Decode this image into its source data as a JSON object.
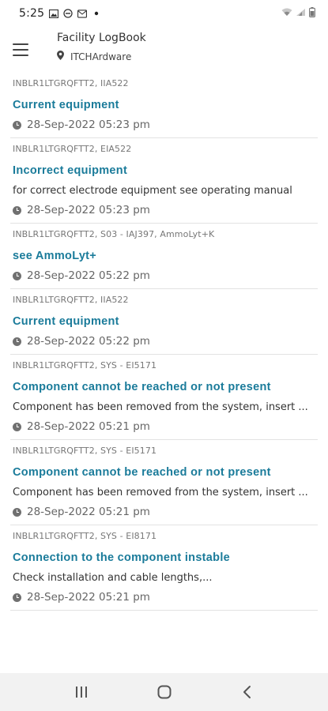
{
  "status_bar": {
    "time": "5:25",
    "left_icons": [
      "gallery-icon",
      "do-not-disturb-icon",
      "message-icon",
      "dot-icon"
    ],
    "right_icons": [
      "wifi-icon",
      "signal-icon",
      "battery-icon"
    ]
  },
  "header": {
    "title": "Facility LogBook",
    "location": "ITCHArdware",
    "menu_icon": "hamburger-menu-icon",
    "location_icon": "location-pin-icon"
  },
  "entries": [
    {
      "code": "INBLR1LTGRQFTT2, IIA522",
      "title": "Current equipment",
      "description": "",
      "time": "28-Sep-2022 05:23 pm"
    },
    {
      "code": "INBLR1LTGRQFTT2, EIA522",
      "title": "Incorrect equipment",
      "description": "for correct electrode equipment see operating manual",
      "time": "28-Sep-2022 05:23 pm"
    },
    {
      "code": "INBLR1LTGRQFTT2, S03 - IAJ397, AmmoLyt+K",
      "title": "see AmmoLyt+",
      "description": "",
      "time": "28-Sep-2022 05:22 pm"
    },
    {
      "code": "INBLR1LTGRQFTT2, IIA522",
      "title": "Current equipment",
      "description": "",
      "time": "28-Sep-2022 05:22 pm"
    },
    {
      "code": "INBLR1LTGRQFTT2, SYS - EI5171",
      "title": "Component cannot be reached or not present",
      "description": "Component has been removed from the system, insert ...",
      "time": "28-Sep-2022 05:21 pm"
    },
    {
      "code": "INBLR1LTGRQFTT2, SYS - EI5171",
      "title": "Component cannot be reached or not present",
      "description": "Component has been removed from the system, insert ...",
      "time": "28-Sep-2022 05:21 pm"
    },
    {
      "code": "INBLR1LTGRQFTT2, SYS - EI8171",
      "title": "Connection to the component instable",
      "description": "Check installation and cable lengths,...",
      "time": "28-Sep-2022 05:21 pm"
    }
  ],
  "nav_bar": {
    "recents_icon": "recents-icon",
    "home_icon": "home-icon",
    "back_icon": "back-icon"
  }
}
